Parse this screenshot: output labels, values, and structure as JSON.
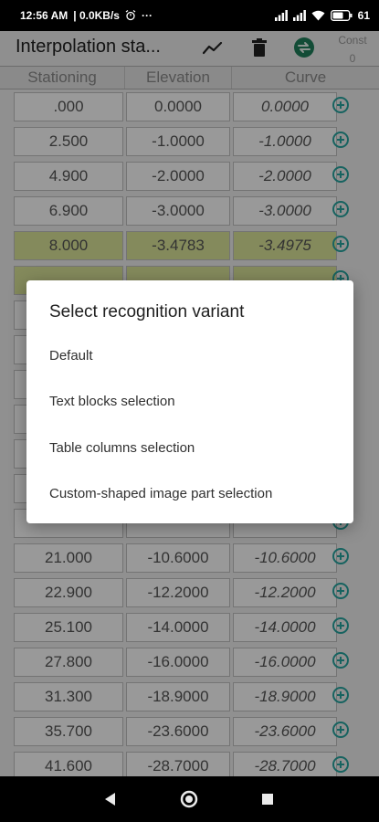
{
  "status_bar": {
    "time": "12:56 AM",
    "net_speed": "| 0.0KB/s",
    "more": "···",
    "battery": "61"
  },
  "app_bar": {
    "title": "Interpolation sta...",
    "const_label": "Const",
    "const_value": "0",
    "icons": [
      "line-chart-icon",
      "trash-icon",
      "swap-icon"
    ]
  },
  "table": {
    "headers": [
      "Stationing",
      "Elevation",
      "Curve"
    ],
    "rows": [
      {
        "station": ".000",
        "elevation": "0.0000",
        "curve": "0.0000",
        "highlighted": false
      },
      {
        "station": "2.500",
        "elevation": "-1.0000",
        "curve": "-1.0000",
        "highlighted": false
      },
      {
        "station": "4.900",
        "elevation": "-2.0000",
        "curve": "-2.0000",
        "highlighted": false
      },
      {
        "station": "6.900",
        "elevation": "-3.0000",
        "curve": "-3.0000",
        "highlighted": false
      },
      {
        "station": "8.000",
        "elevation": "-3.4783",
        "curve": "-3.4975",
        "highlighted": true
      },
      {
        "station": "",
        "elevation": "",
        "curve": "",
        "highlighted": true
      },
      {
        "station": "",
        "elevation": "",
        "curve": "",
        "highlighted": false
      },
      {
        "station": "",
        "elevation": "",
        "curve": "",
        "highlighted": false
      },
      {
        "station": "",
        "elevation": "",
        "curve": "",
        "highlighted": false
      },
      {
        "station": "",
        "elevation": "",
        "curve": "",
        "highlighted": false
      },
      {
        "station": "",
        "elevation": "",
        "curve": "",
        "highlighted": false
      },
      {
        "station": "",
        "elevation": "",
        "curve": "",
        "highlighted": false
      },
      {
        "station": "",
        "elevation": "",
        "curve": "",
        "highlighted": false
      },
      {
        "station": "21.000",
        "elevation": "-10.6000",
        "curve": "-10.6000",
        "highlighted": false
      },
      {
        "station": "22.900",
        "elevation": "-12.2000",
        "curve": "-12.2000",
        "highlighted": false
      },
      {
        "station": "25.100",
        "elevation": "-14.0000",
        "curve": "-14.0000",
        "highlighted": false
      },
      {
        "station": "27.800",
        "elevation": "-16.0000",
        "curve": "-16.0000",
        "highlighted": false
      },
      {
        "station": "31.300",
        "elevation": "-18.9000",
        "curve": "-18.9000",
        "highlighted": false
      },
      {
        "station": "35.700",
        "elevation": "-23.6000",
        "curve": "-23.6000",
        "highlighted": false
      },
      {
        "station": "41.600",
        "elevation": "-28.7000",
        "curve": "-28.7000",
        "highlighted": false
      }
    ]
  },
  "dialog": {
    "title": "Select recognition variant",
    "items": [
      "Default",
      "Text blocks selection",
      "Table columns selection",
      "Custom-shaped image part selection"
    ]
  },
  "nav_bar": {
    "icons": [
      "back-icon",
      "home-icon",
      "recents-icon"
    ]
  },
  "colors": {
    "highlight_row": "#dde79a",
    "accent_teal": "#27a5a0",
    "swap_button": "#1f7f5a",
    "cell_background": "#ffffff"
  }
}
